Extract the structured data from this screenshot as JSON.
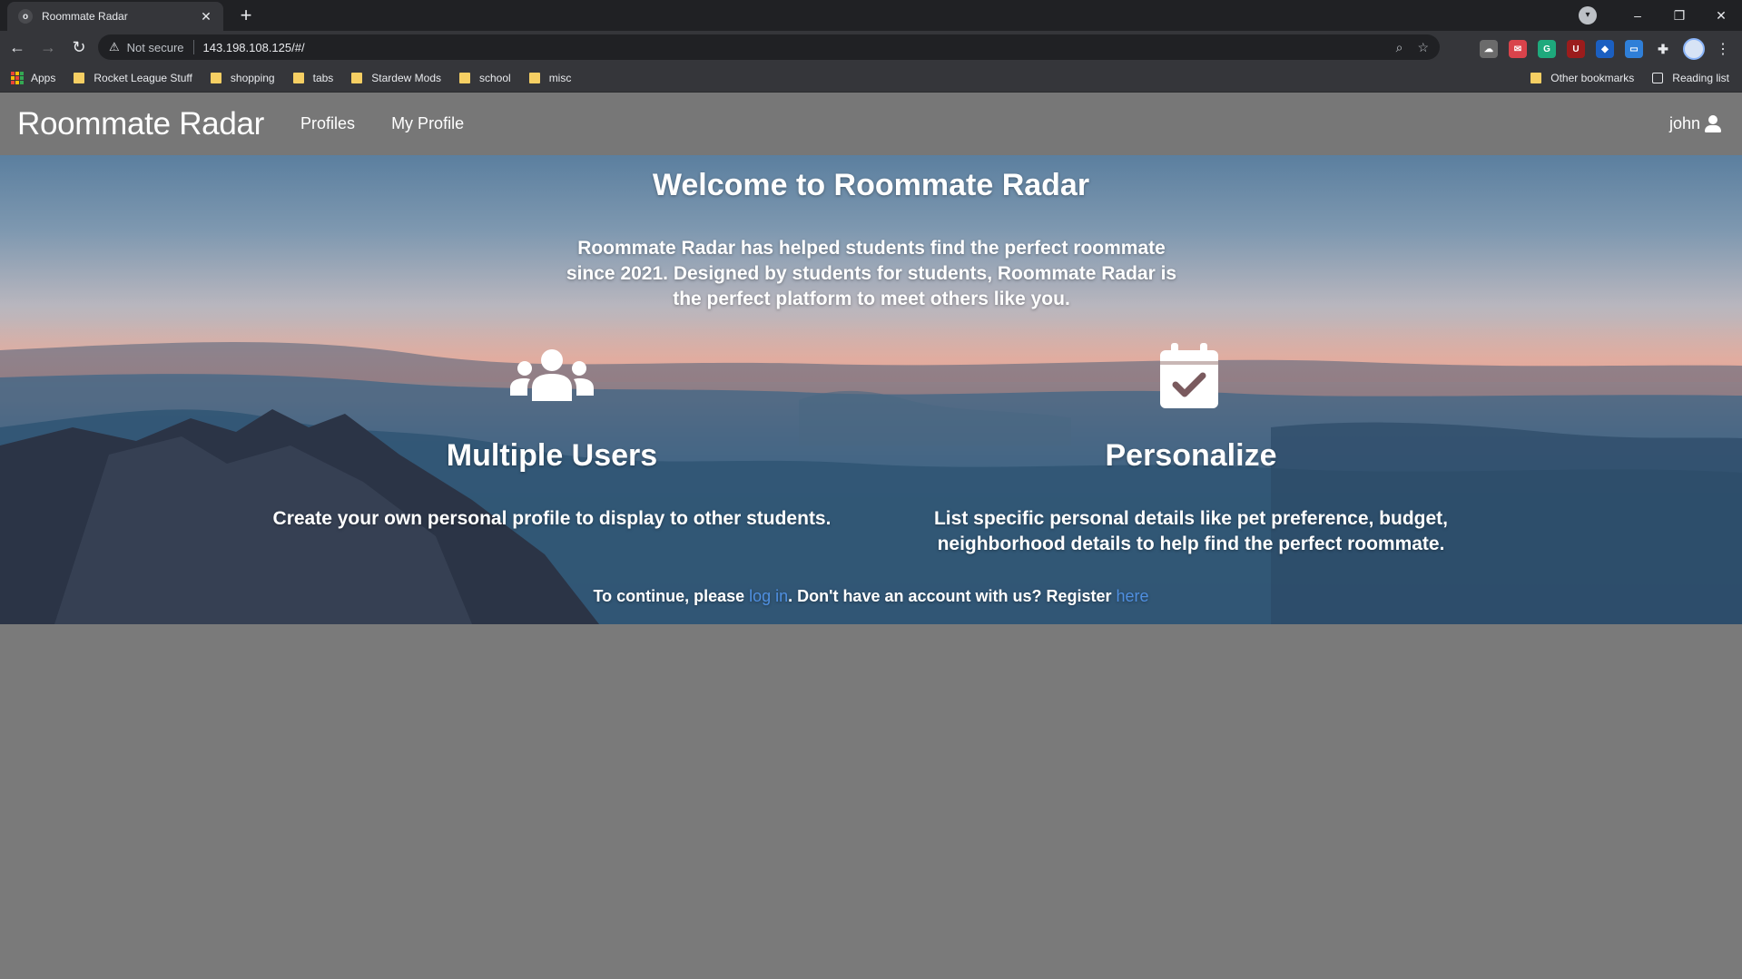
{
  "browser": {
    "tab_title": "Roommate Radar",
    "favicon_glyph": "o",
    "new_tab": "+",
    "window_controls": [
      "–",
      "❐",
      "✕"
    ],
    "security_label": "Not secure",
    "url": "143.198.108.125/#/",
    "bookmarks": [
      {
        "label": "Apps",
        "icon": "apps-grid-icon"
      },
      {
        "label": "Rocket League Stuff",
        "icon": "folder-icon"
      },
      {
        "label": "shopping",
        "icon": "folder-icon"
      },
      {
        "label": "tabs",
        "icon": "folder-icon"
      },
      {
        "label": "Stardew Mods",
        "icon": "folder-icon"
      },
      {
        "label": "school",
        "icon": "folder-icon"
      },
      {
        "label": "misc",
        "icon": "folder-icon"
      }
    ],
    "other_bookmarks": "Other bookmarks",
    "reading_list": "Reading list"
  },
  "site": {
    "brand": "Roommate Radar",
    "nav": [
      "Profiles",
      "My Profile"
    ],
    "username": "john",
    "accent_link_color": "#4f8fe0"
  },
  "hero": {
    "title": "Welcome to Roommate Radar",
    "intro": "Roommate Radar has helped students find the perfect roommate since 2021. Designed by students for students, Roommate Radar is the perfect platform to meet others like you.",
    "features": [
      {
        "title": "Multiple Users",
        "text": "Create your own personal profile to display to other students.",
        "icon": "users-icon"
      },
      {
        "title": "Personalize",
        "text": "List specific personal details like pet preference, budget, neighborhood details to help find the perfect roommate.",
        "icon": "calendar-check-icon"
      }
    ],
    "cta": {
      "prefix": "To continue, please ",
      "login_link": "log in",
      "middle": ". Don't have an account with us? Register ",
      "register_link": "here"
    }
  }
}
